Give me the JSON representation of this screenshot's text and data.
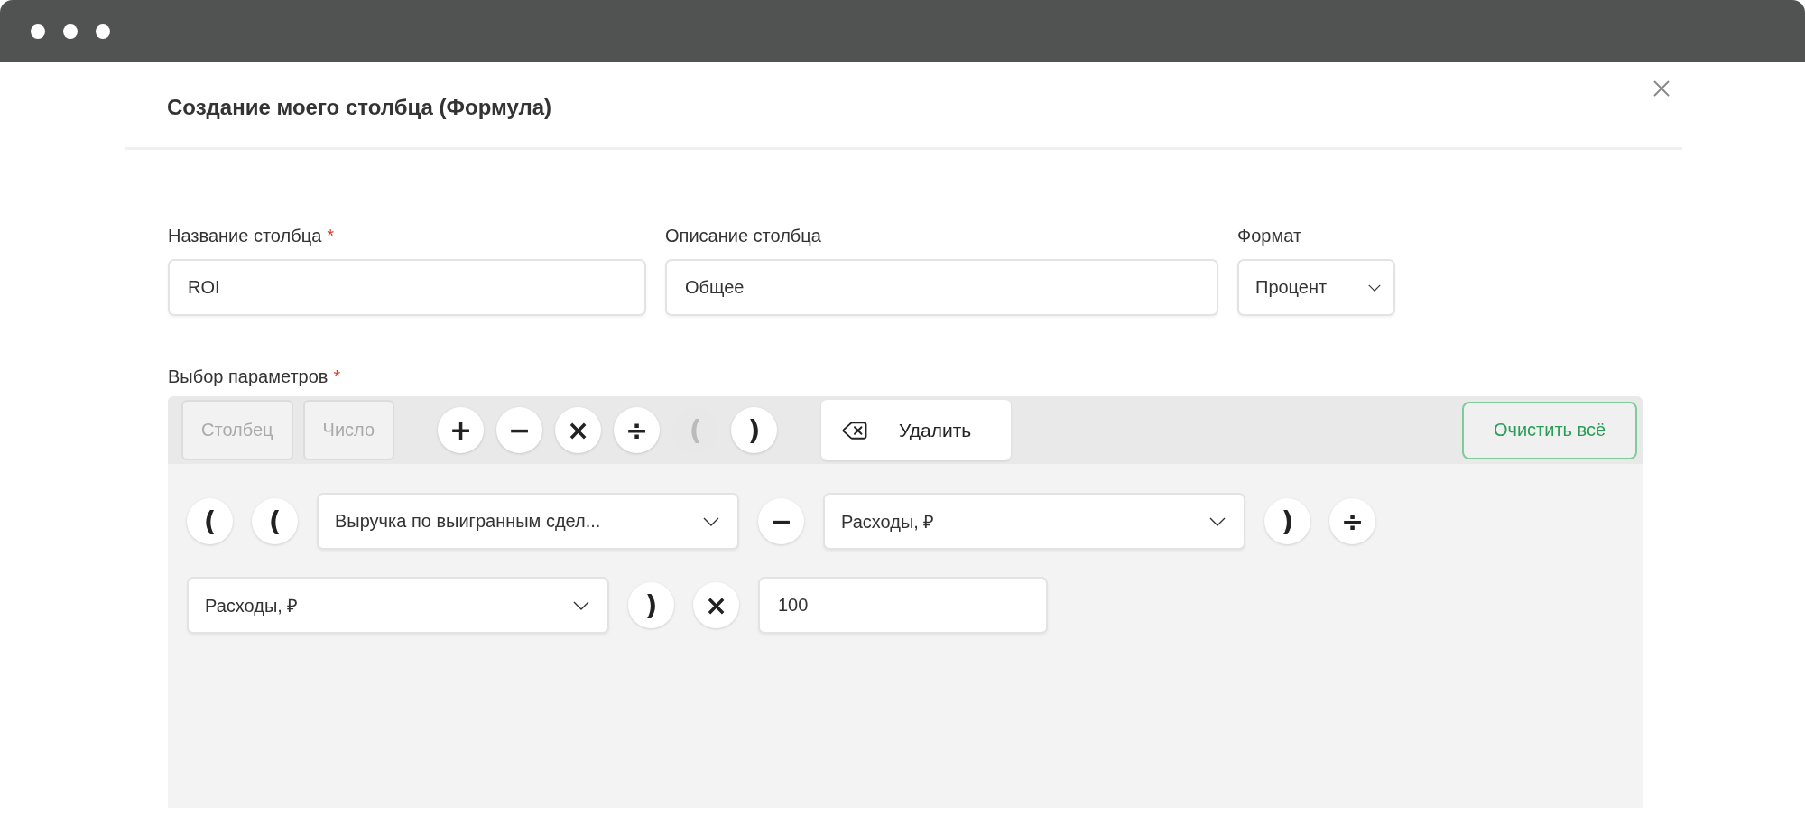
{
  "window": {
    "title": "Создание моего столбца (Формула)"
  },
  "fields": [
    {
      "label": "Название столбца",
      "required_mark": "*",
      "kind": "text",
      "value": "ROI"
    },
    {
      "label": "Описание столбца",
      "kind": "text",
      "value": "Общее"
    },
    {
      "label": "Формат",
      "kind": "select",
      "value": "Процент"
    }
  ],
  "parameters": {
    "label": "Выбор параметров",
    "required_mark": "*",
    "toolbar": [
      {
        "kind": "tab",
        "label": "Столбец",
        "disabled": true
      },
      {
        "kind": "tab",
        "label": "Число",
        "disabled": true
      },
      {
        "kind": "operator",
        "label": "+",
        "disabled": false
      },
      {
        "kind": "operator",
        "label": "−",
        "disabled": false
      },
      {
        "kind": "operator",
        "label": "×",
        "disabled": false
      },
      {
        "kind": "operator",
        "label": "÷",
        "disabled": false
      },
      {
        "kind": "operator",
        "label": "(",
        "disabled": true
      },
      {
        "kind": "operator",
        "label": ")",
        "disabled": false
      },
      {
        "kind": "delete",
        "label": "Удалить",
        "disabled": false
      },
      {
        "kind": "clear",
        "label": "Очистить всё",
        "disabled": false
      }
    ],
    "formula": [
      [
        {
          "kind": "token",
          "text": "("
        },
        {
          "kind": "token",
          "text": "("
        },
        {
          "kind": "select",
          "value": "Выручка по выигранным сдел..."
        },
        {
          "kind": "token",
          "text": "−"
        },
        {
          "kind": "select",
          "value": "Расходы, ₽"
        },
        {
          "kind": "token",
          "text": ")"
        },
        {
          "kind": "token",
          "text": "÷"
        }
      ],
      [
        {
          "kind": "select",
          "value": "Расходы, ₽"
        },
        {
          "kind": "token",
          "text": ")"
        },
        {
          "kind": "token",
          "text": "×"
        },
        {
          "kind": "number",
          "value": "100"
        }
      ]
    ]
  }
}
